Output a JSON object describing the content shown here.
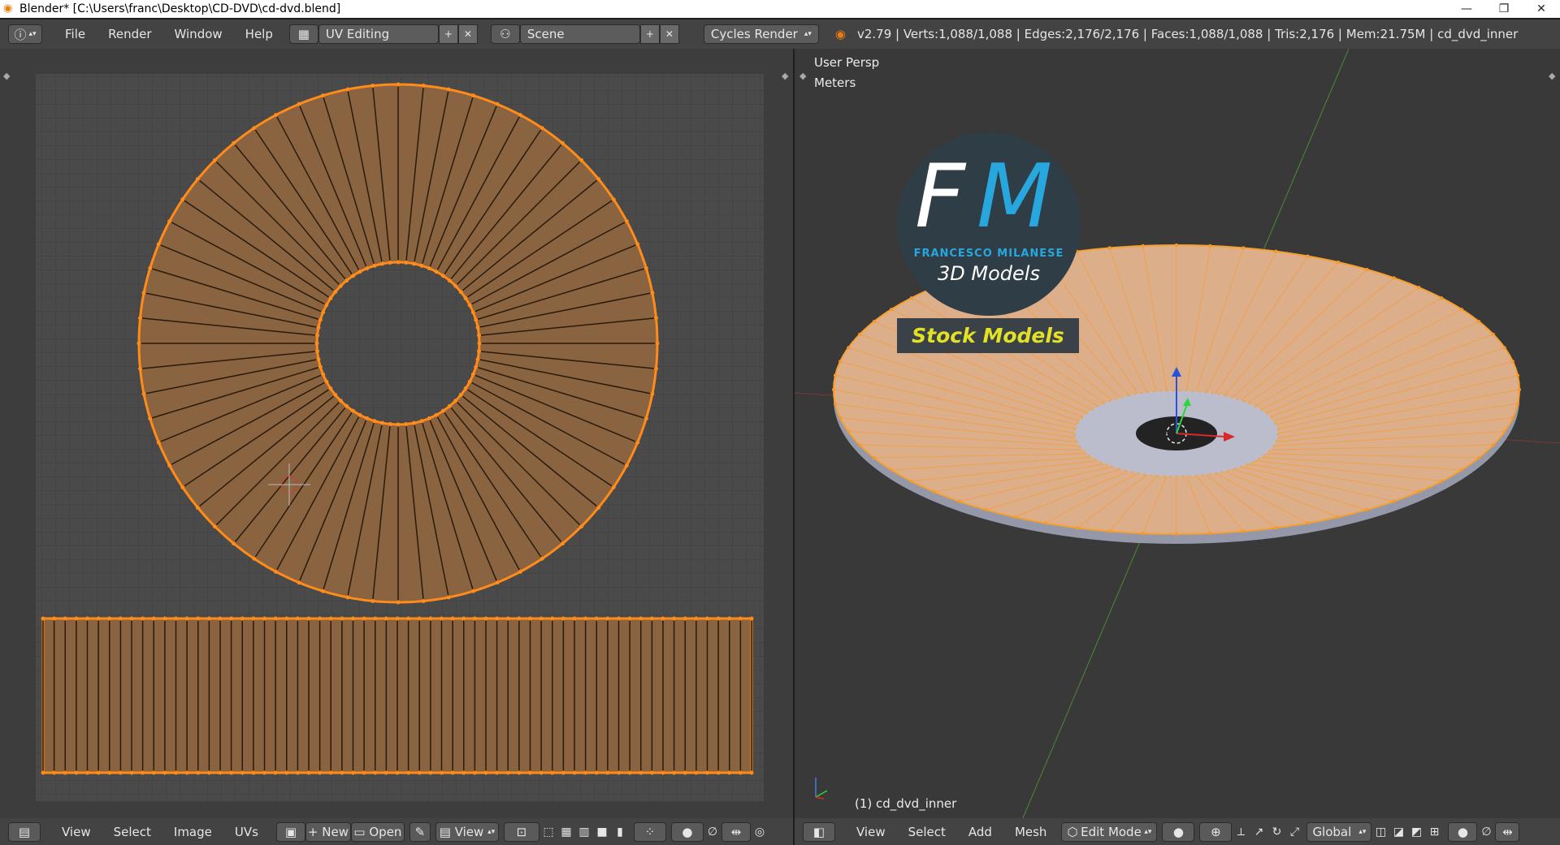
{
  "window": {
    "title": "Blender* [C:\\Users\\franc\\Desktop\\CD-DVD\\cd-dvd.blend]"
  },
  "topbar": {
    "menus": [
      "File",
      "Render",
      "Window",
      "Help"
    ],
    "screen_layout": "UV Editing",
    "scene": "Scene",
    "render_engine": "Cycles Render",
    "stats": "v2.79 | Verts:1,088/1,088 | Edges:2,176/2,176 | Faces:1,088/1,088 | Tris:2,176 | Mem:21.75M | cd_dvd_inner"
  },
  "uv_editor": {
    "menus": [
      "View",
      "Select",
      "Image",
      "UVs"
    ],
    "new_label": "New",
    "open_label": "Open",
    "view_label": "View"
  },
  "viewport": {
    "view_name": "User Persp",
    "units": "Meters",
    "object_label": "(1) cd_dvd_inner",
    "menus": [
      "View",
      "Select",
      "Add",
      "Mesh"
    ],
    "mode": "Edit Mode",
    "orientation": "Global"
  },
  "watermark": {
    "letter_f": "F",
    "letter_m": "M",
    "name": "FRANCESCO MILANESE",
    "subtitle": "3D Models",
    "banner": "Stock Models"
  },
  "colors": {
    "accent": "#e87d0d",
    "uv_orange": "#ff8c1a",
    "disc_fill": "#dcae8a"
  },
  "icons": [
    "info-icon",
    "layout-icon",
    "scene-icon",
    "blender-logo-icon",
    "pin-icon",
    "cube-icon",
    "render-icon"
  ]
}
